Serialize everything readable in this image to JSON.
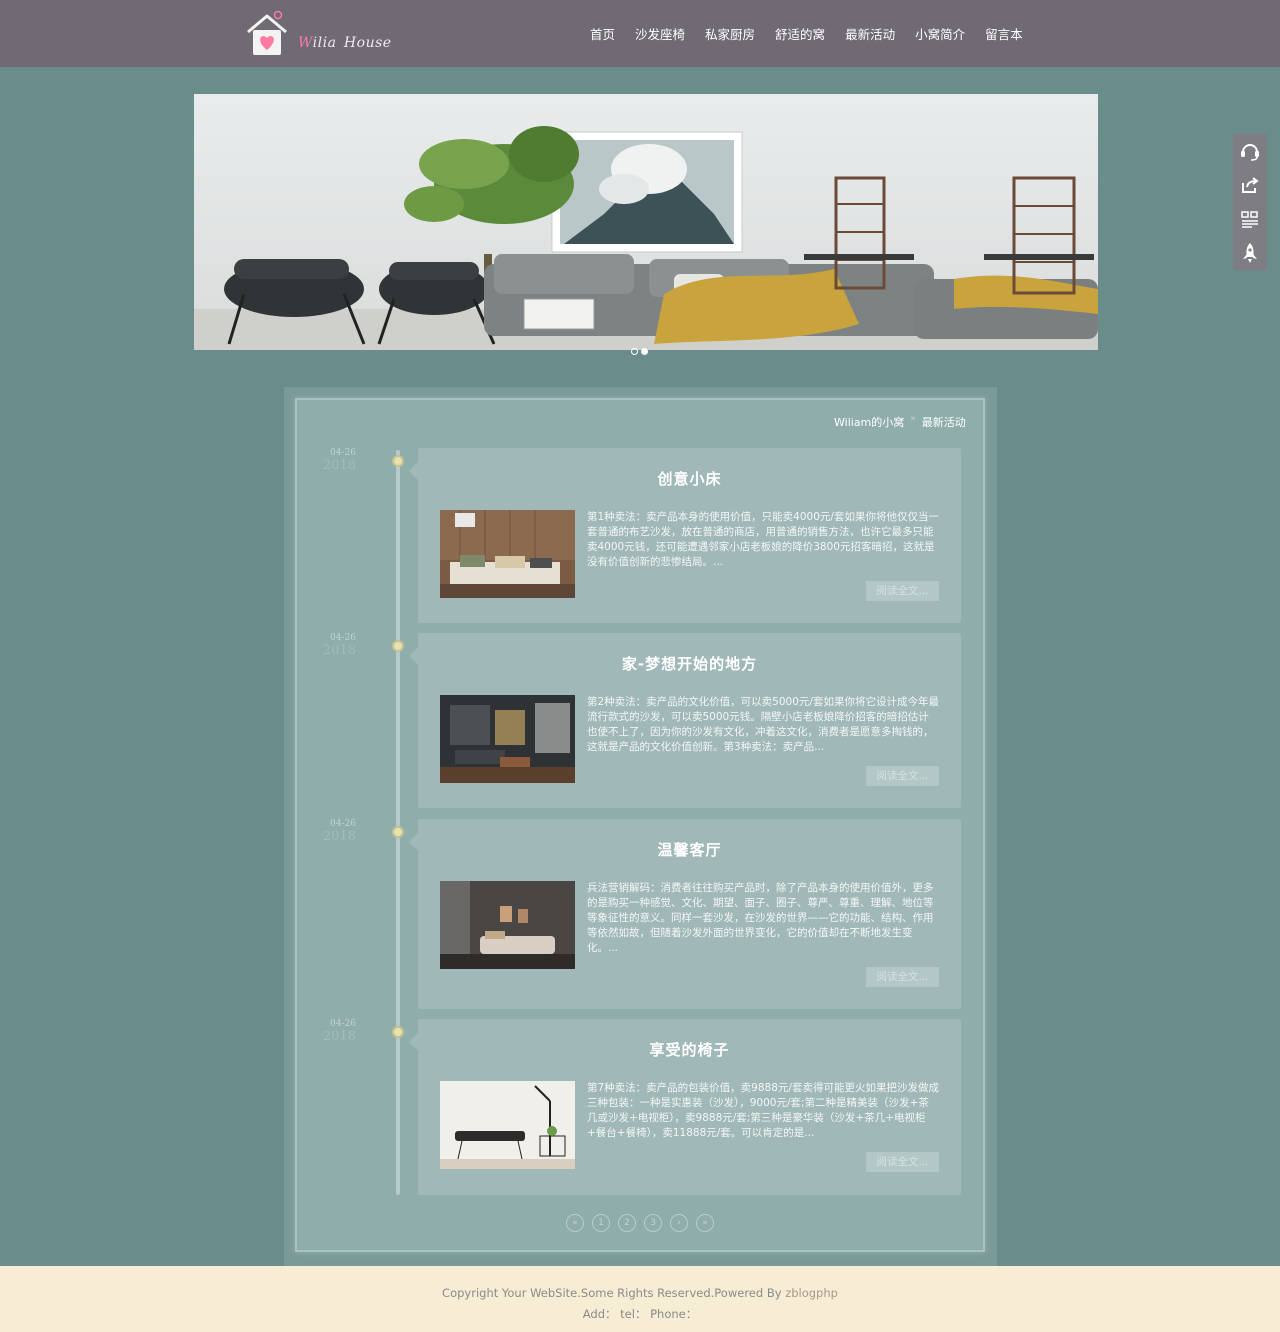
{
  "header": {
    "logo_text_first": "W",
    "logo_text_rest": "ilia House",
    "nav": [
      "首页",
      "沙发座椅",
      "私家厨房",
      "舒适的窝",
      "最新活动",
      "小窝简介",
      "留言本"
    ]
  },
  "banner": {
    "slide_count": 2,
    "active_slide": 2
  },
  "side_tools": [
    "headset-icon",
    "share-icon",
    "qrcode-icon",
    "rocket-icon"
  ],
  "breadcrumb": {
    "home": "Wiliam的小窝",
    "separator": "»",
    "current": "最新活动"
  },
  "posts": [
    {
      "month_day": "04-26",
      "year": "2018",
      "title": "创意小床",
      "excerpt": "第1种卖法：卖产品本身的使用价值，只能卖4000元/套如果你将他仅仅当一套普通的布艺沙发，放在普通的商店，用普通的销售方法，也许它最多只能卖4000元钱，还可能遭遇邻家小店老板娘的降价3800元招客暗招，这就是没有价值创新的悲惨结局。...",
      "read_more": "阅读全文..."
    },
    {
      "month_day": "04-26",
      "year": "2018",
      "title": "家-梦想开始的地方",
      "excerpt": "第2种卖法：卖产品的文化价值，可以卖5000元/套如果你将它设计成今年最流行款式的沙发，可以卖5000元钱。隔壁小店老板娘降价招客的暗招估计也使不上了，因为你的沙发有文化，冲着这文化，消费者是愿意多掏钱的，这就是产品的文化价值创新。第3种卖法：卖产品...",
      "read_more": "阅读全文..."
    },
    {
      "month_day": "04-26",
      "year": "2018",
      "title": "温馨客厅",
      "excerpt": "兵法营销解码：消费者往往购买产品时，除了产品本身的使用价值外，更多的是购买一种感觉、文化、期望、面子、圈子、尊严、尊重、理解、地位等等象征性的意义。同样一套沙发，在沙发的世界——它的功能、结构、作用等依然如故，但随着沙发外面的世界变化，它的价值却在不断地发生变化。...",
      "read_more": "阅读全文..."
    },
    {
      "month_day": "04-26",
      "year": "2018",
      "title": "享受的椅子",
      "excerpt": "第7种卖法：卖产品的包装价值，卖9888元/套卖得可能更火如果把沙发做成三种包装：一种是实惠装（沙发），9000元/套;第二种是精美装（沙发+茶几或沙发+电视柜），卖9888元/套;第三种是豪华装（沙发+茶几+电视柜+餐台+餐椅），卖11888元/套。可以肯定的是...",
      "read_more": "阅读全文..."
    }
  ],
  "pagination": [
    "«",
    "1",
    "2",
    "3",
    "›",
    "»"
  ],
  "footer": {
    "copyright": "Copyright Your WebSite.Some Rights Reserved.Powered By ",
    "powered_by": "zblogphp",
    "contact": "Add：  tel：  Phone："
  },
  "colors": {
    "page_bg": "#6a8c8a",
    "header_bg": "#6f6a74",
    "card_bg": "#a0b8b7",
    "footer_bg": "#f7edd5",
    "timeline_dot": "#e7e2b0"
  }
}
